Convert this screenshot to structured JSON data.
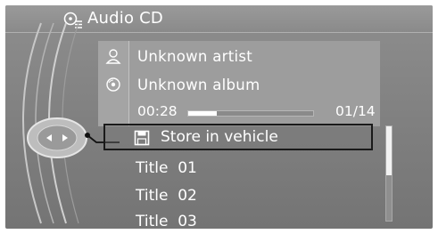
{
  "header": {
    "title": "Audio CD",
    "icon": "cd-settings-icon"
  },
  "info": {
    "artist": "Unknown artist",
    "album": "Unknown album",
    "artist_icon": "person-icon",
    "album_icon": "disc-icon",
    "elapsed": "00:28",
    "progress": 0.23,
    "track_counter": "01/14"
  },
  "list": {
    "store_label": "Store in vehicle",
    "store_icon": "save-icon",
    "titles": [
      "Title  01",
      "Title  02",
      "Title  03"
    ]
  },
  "scroll": {
    "thumb_fraction": 0.52
  },
  "controller": {
    "icon": "controller-knob-icon"
  },
  "colors": {
    "background": "#7e7e7e",
    "text": "#ffffff",
    "selection_border": "#1a1a1a"
  }
}
